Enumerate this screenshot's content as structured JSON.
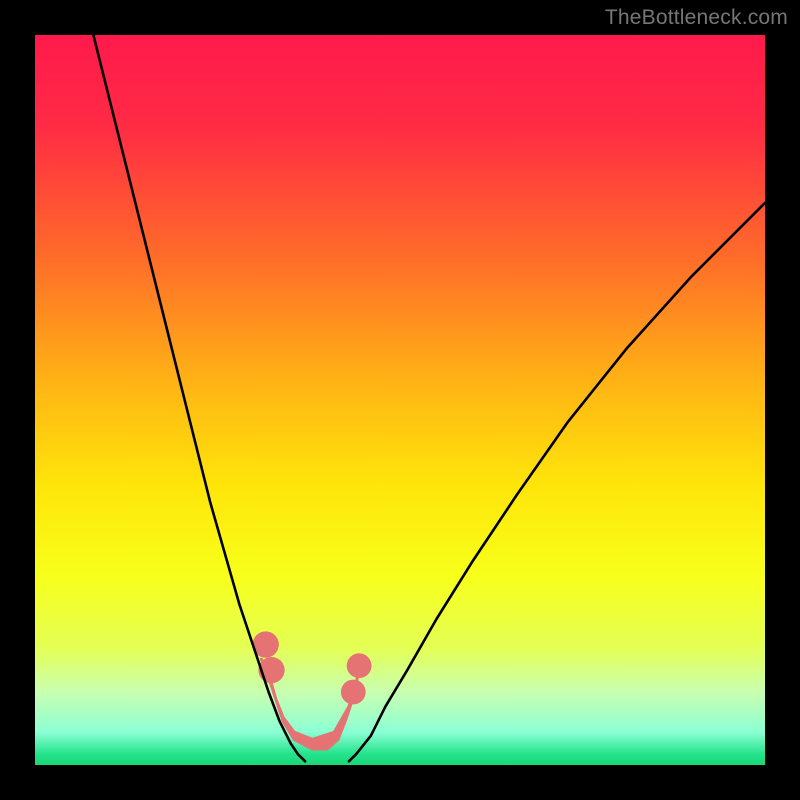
{
  "watermark": "TheBottleneck.com",
  "chart_data": {
    "type": "line",
    "title": "",
    "xlabel": "",
    "ylabel": "",
    "xlim": [
      0,
      100
    ],
    "ylim": [
      0,
      100
    ],
    "grid": false,
    "legend": false,
    "gradient_stops": [
      {
        "pos": 0.0,
        "color": "#ff1a4c"
      },
      {
        "pos": 0.12,
        "color": "#ff2a45"
      },
      {
        "pos": 0.3,
        "color": "#ff6a2a"
      },
      {
        "pos": 0.48,
        "color": "#ffb514"
      },
      {
        "pos": 0.62,
        "color": "#ffe60a"
      },
      {
        "pos": 0.74,
        "color": "#f7ff1a"
      },
      {
        "pos": 0.84,
        "color": "#e4ff55"
      },
      {
        "pos": 0.9,
        "color": "#c8ffb0"
      },
      {
        "pos": 0.955,
        "color": "#8cffd4"
      },
      {
        "pos": 0.985,
        "color": "#24e38b"
      },
      {
        "pos": 1.0,
        "color": "#1ad877"
      }
    ],
    "series": [
      {
        "name": "left-curve",
        "stroke": "#000000",
        "x": [
          8,
          10,
          12,
          14,
          16,
          18,
          20,
          22,
          24,
          26,
          28,
          30,
          32,
          33.5,
          35,
          36,
          37
        ],
        "y": [
          100,
          92,
          84,
          76,
          68,
          60,
          52,
          44,
          36,
          29,
          22,
          16,
          10,
          6,
          3,
          1.5,
          0.5
        ]
      },
      {
        "name": "right-curve",
        "stroke": "#000000",
        "x": [
          43,
          44,
          46,
          48,
          51,
          55,
          60,
          66,
          73,
          81,
          90,
          100
        ],
        "y": [
          0.5,
          1.5,
          4,
          8,
          13,
          20,
          28,
          37,
          47,
          57,
          67,
          77
        ]
      },
      {
        "name": "salmon-blob-outline",
        "stroke": "#e57373",
        "fill": "#e57373",
        "type": "area",
        "x": [
          31,
          32,
          33,
          34,
          35.5,
          38,
          40,
          41.5,
          42.5,
          43.5,
          44,
          44.3,
          44,
          43,
          41,
          38,
          35.5,
          34,
          33,
          32,
          31.3,
          31
        ],
        "y": [
          14.5,
          12.5,
          9,
          6,
          3.5,
          2.2,
          2.2,
          3.5,
          6,
          9,
          11,
          13,
          11,
          8,
          4.5,
          3.5,
          4.5,
          6.5,
          9,
          12,
          14,
          14.5
        ]
      }
    ],
    "blob_bumps": [
      {
        "cx": 31.6,
        "cy": 16.5,
        "r": 1.8
      },
      {
        "cx": 32.4,
        "cy": 13.0,
        "r": 1.8
      },
      {
        "cx": 43.6,
        "cy": 10.0,
        "r": 1.7
      },
      {
        "cx": 44.4,
        "cy": 13.6,
        "r": 1.7
      }
    ]
  }
}
